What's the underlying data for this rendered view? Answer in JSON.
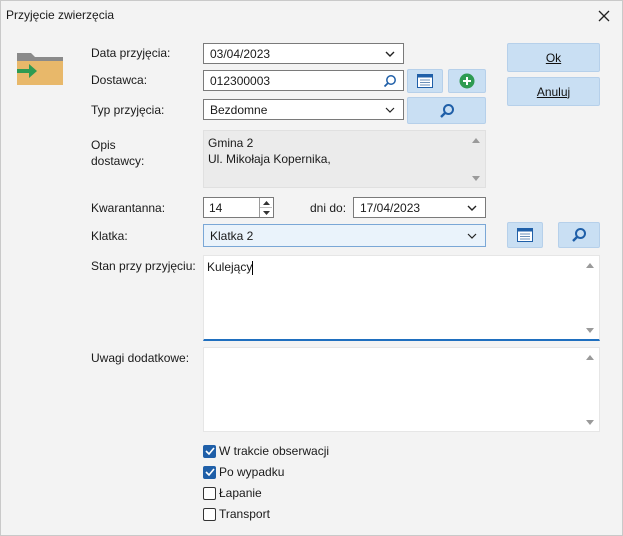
{
  "window": {
    "title": "Przyjęcie zwierzęcia"
  },
  "icons": {
    "close": "close-icon",
    "folder": "folder-arrow-icon",
    "search": "search-icon",
    "calendar": "calendar-list-icon",
    "add": "add-circle-icon",
    "chevron": "chevron-down-icon"
  },
  "colors": {
    "button_bg": "#c9dff3",
    "accent": "#1f6fbf",
    "add_green": "#2e9b52",
    "folder": "#e8b86a"
  },
  "form": {
    "data_przyjecia": {
      "label": "Data przyjęcia:",
      "value": "03/04/2023"
    },
    "dostawca": {
      "label": "Dostawca:",
      "value": "012300003"
    },
    "typ_przyjecia": {
      "label": "Typ przyjęcia:",
      "value": "Bezdomne"
    },
    "opis_dostawcy": {
      "label_line1": "Opis",
      "label_line2": "dostawcy:",
      "line1": "Gmina 2",
      "line2": "Ul. Mikołaja Kopernika,"
    },
    "kwarantanna": {
      "label": "Kwarantanna:",
      "value": "14",
      "dni_label": "dni do:",
      "date": "17/04/2023"
    },
    "klatka": {
      "label": "Klatka:",
      "value": "Klatka 2"
    },
    "stan": {
      "label": "Stan przy przyjęciu:",
      "value": "Kulejący"
    },
    "uwagi": {
      "label": "Uwagi dodatkowe:",
      "value": ""
    }
  },
  "buttons": {
    "ok": "Ok",
    "anuluj": "Anuluj"
  },
  "checkboxes": [
    {
      "label": "W trakcie obserwacji",
      "checked": true
    },
    {
      "label": "Po wypadku",
      "checked": true
    },
    {
      "label": "Łapanie",
      "checked": false
    },
    {
      "label": "Transport",
      "checked": false
    }
  ]
}
